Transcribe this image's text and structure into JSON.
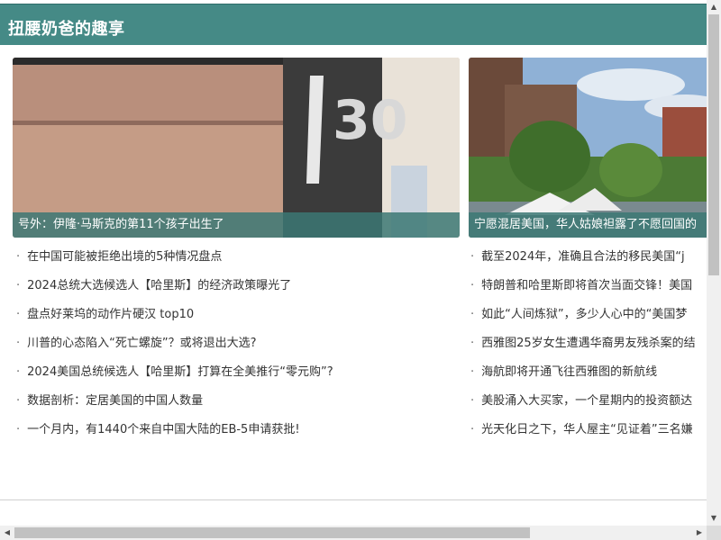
{
  "header": {
    "title": "扭腰奶爸的趣享"
  },
  "cards": [
    {
      "caption": "号外：伊隆·马斯克的第11个孩子出生了"
    },
    {
      "caption": "宁愿混居美国，华人姑娘袒露了不愿回国的"
    }
  ],
  "bullet": "·",
  "lists": [
    [
      "在中国可能被拒绝出境的5种情况盘点",
      "2024总统大选候选人【哈里斯】的经济政策曝光了",
      "盘点好莱坞的动作片硬汉 top10",
      "川普的心态陷入“死亡螺旋”？或将退出大选?",
      "2024美国总统候选人【哈里斯】打算在全美推行“零元购”?",
      "数据剖析：定居美国的中国人数量",
      "一个月内，有1440个来自中国大陆的EB-5申请获批!"
    ],
    [
      "截至2024年，准确且合法的移民美国“j",
      "特朗普和哈里斯即将首次当面交锋！美国",
      "如此“人间炼狱”，多少人心中的“美国梦",
      "西雅图25岁女生遭遇华裔男友残杀案的结",
      "海航即将开通飞往西雅图的新航线",
      "美股涌入大买家，一个星期内的投资额达",
      "光天化日之下，华人屋主“见证着”三名嫌"
    ]
  ],
  "scrollbars": {
    "up_icon": "arrow-up-icon",
    "down_icon": "arrow-down-icon",
    "left_icon": "arrow-left-icon",
    "right_icon": "arrow-right-icon"
  }
}
